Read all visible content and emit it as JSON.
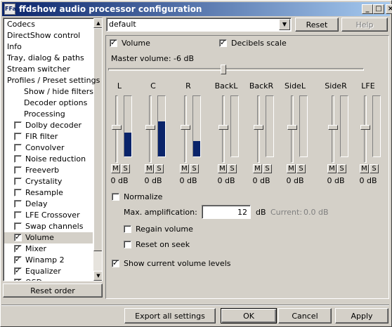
{
  "window": {
    "title": "ffdshow audio processor configuration",
    "icon_text": "FFa",
    "minimize": "_",
    "maximize": "□",
    "close": "×"
  },
  "sidebar": {
    "items": [
      {
        "label": "Codecs",
        "checkbox": false,
        "checked": false,
        "indent": false
      },
      {
        "label": "DirectShow control",
        "checkbox": false,
        "checked": false,
        "indent": false
      },
      {
        "label": "Info",
        "checkbox": false,
        "checked": false,
        "indent": false
      },
      {
        "label": "Tray, dialog & paths",
        "checkbox": false,
        "checked": false,
        "indent": false
      },
      {
        "label": "Stream switcher",
        "checkbox": false,
        "checked": false,
        "indent": false
      },
      {
        "label": "Profiles / Preset settings",
        "checkbox": false,
        "checked": false,
        "indent": false
      },
      {
        "label": "Show / hide filters",
        "checkbox": false,
        "checked": false,
        "indent": true
      },
      {
        "label": "Decoder options",
        "checkbox": false,
        "checked": false,
        "indent": true
      },
      {
        "label": "Processing",
        "checkbox": false,
        "checked": false,
        "indent": true
      },
      {
        "label": "Dolby decoder",
        "checkbox": true,
        "checked": false,
        "indent": true
      },
      {
        "label": "FIR filter",
        "checkbox": true,
        "checked": false,
        "indent": true
      },
      {
        "label": "Convolver",
        "checkbox": true,
        "checked": false,
        "indent": true
      },
      {
        "label": "Noise reduction",
        "checkbox": true,
        "checked": false,
        "indent": true
      },
      {
        "label": "Freeverb",
        "checkbox": true,
        "checked": false,
        "indent": true
      },
      {
        "label": "Crystality",
        "checkbox": true,
        "checked": false,
        "indent": true
      },
      {
        "label": "Resample",
        "checkbox": true,
        "checked": false,
        "indent": true
      },
      {
        "label": "Delay",
        "checkbox": true,
        "checked": false,
        "indent": true
      },
      {
        "label": "LFE Crossover",
        "checkbox": true,
        "checked": false,
        "indent": true
      },
      {
        "label": "Swap channels",
        "checkbox": true,
        "checked": false,
        "indent": true
      },
      {
        "label": "Volume",
        "checkbox": true,
        "checked": true,
        "indent": true,
        "selected": true
      },
      {
        "label": "Mixer",
        "checkbox": true,
        "checked": true,
        "indent": true
      },
      {
        "label": "Winamp 2",
        "checkbox": true,
        "checked": true,
        "indent": true
      },
      {
        "label": "Equalizer",
        "checkbox": true,
        "checked": true,
        "indent": true
      },
      {
        "label": "OSD",
        "checkbox": true,
        "checked": true,
        "indent": true
      }
    ],
    "reset_order": "Reset order"
  },
  "preset": {
    "selected": "default",
    "reset": "Reset",
    "help": "Help"
  },
  "volume": {
    "enabled_label": "Volume",
    "enabled": true,
    "decibels_label": "Decibels scale",
    "decibels": true,
    "master_label": "Master volume: -6 dB",
    "master_level": 0.45,
    "channels": [
      {
        "name": "L",
        "value": "0 dB",
        "meter": 0.4,
        "mute": "M",
        "solo": "S"
      },
      {
        "name": "C",
        "value": "0 dB",
        "meter": 0.58,
        "mute": "M",
        "solo": "S"
      },
      {
        "name": "R",
        "value": "0 dB",
        "meter": 0.25,
        "mute": "M",
        "solo": "S"
      },
      {
        "name": "BackL",
        "value": "0 dB",
        "meter": 0,
        "mute": "M",
        "solo": "S"
      },
      {
        "name": "BackR",
        "value": "0 dB",
        "meter": 0,
        "mute": "M",
        "solo": "S"
      },
      {
        "name": "SideL",
        "value": "0 dB",
        "meter": 0,
        "mute": "M",
        "solo": "S"
      },
      {
        "name": "SideR",
        "value": "0 dB",
        "meter": 0,
        "mute": "M",
        "solo": "S"
      },
      {
        "name": "LFE",
        "value": "0 dB",
        "meter": 0,
        "mute": "M",
        "solo": "S"
      }
    ],
    "normalize_label": "Normalize",
    "normalize": false,
    "max_amp_label": "Max. amplification:",
    "max_amp_value": "12",
    "max_amp_unit": "dB",
    "current_label": "Current:",
    "current_value": "0.0 dB",
    "regain_label": "Regain volume",
    "regain": false,
    "reset_seek_label": "Reset on seek",
    "reset_seek": false,
    "show_levels_label": "Show current volume levels",
    "show_levels": true
  },
  "footer": {
    "export": "Export all settings",
    "ok": "OK",
    "cancel": "Cancel",
    "apply": "Apply"
  }
}
